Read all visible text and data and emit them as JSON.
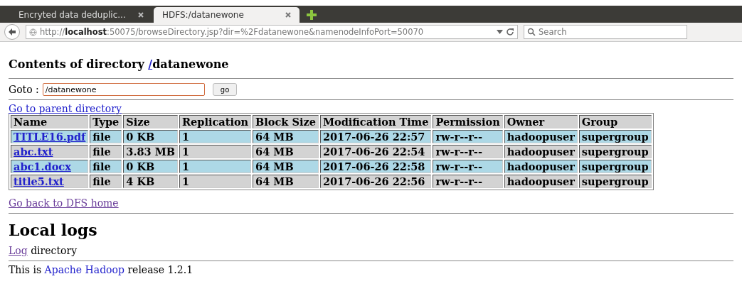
{
  "browser": {
    "tabs": [
      {
        "title": "Encryted data deduplic...",
        "selected": false
      },
      {
        "title": "HDFS:/datanewone",
        "selected": true
      }
    ],
    "address": "http://**localhost**:50075/browseDirectory.jsp?dir=%2Fdatanewone&namenodeInfoPort=50070",
    "search": {
      "placeholder": "Search"
    }
  },
  "page": {
    "heading": {
      "prefix": "Contents of directory ",
      "link": "/",
      "rest": "datanewone"
    },
    "goto": {
      "label": "Goto :",
      "value": "/datanewone",
      "button": "go"
    },
    "parent_link": {
      "text": "Go to parent directory",
      "visited": false
    },
    "table": {
      "columns": [
        "Name",
        "Type",
        "Size",
        "Replication",
        "Block Size",
        "Modification Time",
        "Permission",
        "Owner",
        "Group"
      ],
      "rows": [
        {
          "color": "#add8e6",
          "cells": [
            "TITLE16.pdf",
            "file",
            "0 KB",
            "1",
            "64 MB",
            "2017-06-26 22:57",
            "rw-r--r--",
            "hadoopuser",
            "supergroup"
          ]
        },
        {
          "color": "#d3d3d3",
          "cells": [
            "abc.txt",
            "file",
            "3.83 MB",
            "1",
            "64 MB",
            "2017-06-26 22:54",
            "rw-r--r--",
            "hadoopuser",
            "supergroup"
          ]
        },
        {
          "color": "#add8e6",
          "cells": [
            "abc1.docx",
            "file",
            "0 KB",
            "1",
            "64 MB",
            "2017-06-26 22:58",
            "rw-r--r--",
            "hadoopuser",
            "supergroup"
          ]
        },
        {
          "color": "#d3d3d3",
          "cells": [
            "title5.txt",
            "file",
            "4 KB",
            "1",
            "64 MB",
            "2017-06-26 22:56",
            "rw-r--r--",
            "hadoopuser",
            "supergroup"
          ]
        }
      ]
    },
    "home_link": {
      "text": "Go back to DFS home",
      "visited": true
    },
    "logs_heading": "Local logs",
    "log_line": {
      "link": "Log",
      "link_visited": true,
      "rest": " directory"
    },
    "footer": {
      "prefix": "This is ",
      "link": "Apache Hadoop",
      "rest": " release 1.2.1"
    }
  }
}
